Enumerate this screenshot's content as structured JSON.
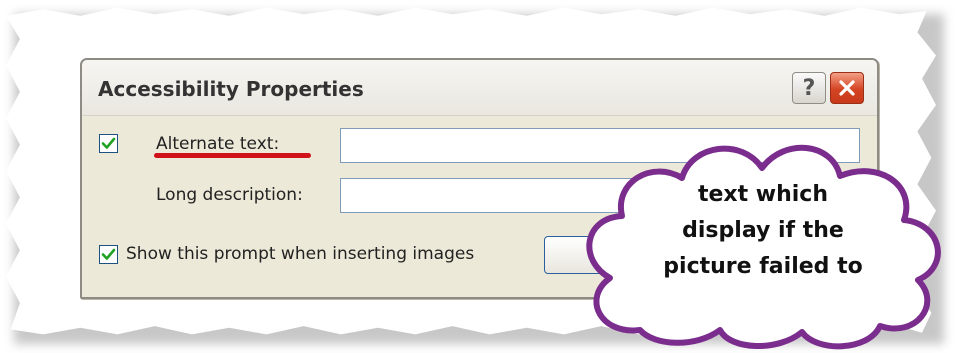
{
  "dialog": {
    "title": "Accessibility Properties",
    "help_glyph": "?",
    "fields": {
      "alternate_text": {
        "label": "Alternate text:",
        "checked": true,
        "value": ""
      },
      "long_description": {
        "label": "Long description:",
        "value": ""
      }
    },
    "show_prompt": {
      "label": "Show this prompt when inserting images",
      "checked": true
    }
  },
  "callout": {
    "lines": [
      "text which",
      "display if the",
      "picture failed to"
    ]
  },
  "icons": {
    "help": "help-icon",
    "close": "close-icon",
    "check": "checkmark-icon"
  },
  "colors": {
    "dialog_bg": "#ece9d8",
    "close_button": "#d44423",
    "checkmark": "#21a121",
    "underline": "#d0111a",
    "cloud_border": "#7b2d8e"
  }
}
